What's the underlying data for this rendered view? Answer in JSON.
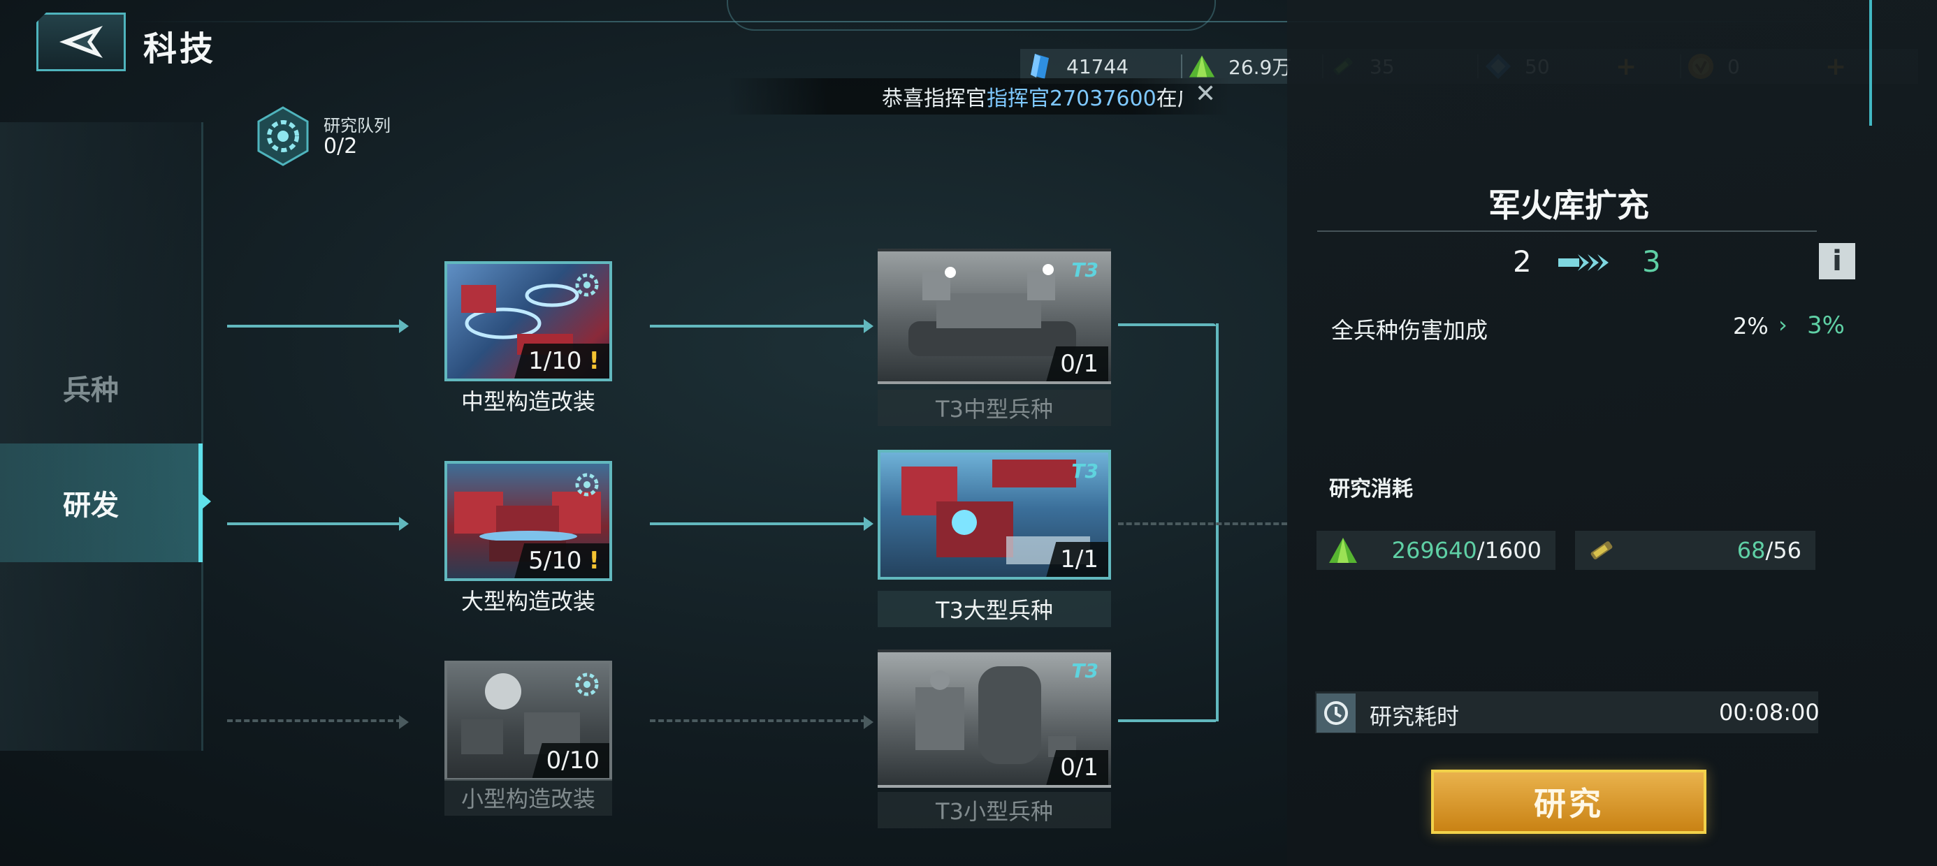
{
  "header": {
    "title": "科技",
    "resources": [
      {
        "icon": "blue-crystal-icon",
        "value": "41744",
        "plus": ""
      },
      {
        "icon": "green-ore-icon",
        "value": "26.9万",
        "plus": ""
      },
      {
        "icon": "green-battery-icon",
        "value": "35",
        "plus": ""
      },
      {
        "icon": "blue-ticket-icon",
        "value": "50",
        "plus": "+"
      },
      {
        "icon": "gold-medal-icon",
        "value": "0",
        "plus": "+"
      }
    ],
    "notice": {
      "prefix": "恭喜指挥官",
      "link": "指挥官27037600",
      "suffix": "在广"
    }
  },
  "queue": {
    "label": "研究队列",
    "value": "0/2"
  },
  "nav": {
    "troops": "兵种",
    "rnd": "研发"
  },
  "tree": {
    "mid_mod": {
      "name": "中型构造改装",
      "progress": "1/10",
      "alert": "!"
    },
    "large_mod": {
      "name": "大型构造改装",
      "progress": "5/10",
      "alert": "!"
    },
    "small_mod": {
      "name": "小型构造改装",
      "progress": "0/10"
    },
    "t3_mid": {
      "name": "T3中型兵种",
      "progress": "0/1",
      "tier": "T3"
    },
    "t3_large": {
      "name": "T3大型兵种",
      "progress": "1/1",
      "tier": "T3"
    },
    "t3_small": {
      "name": "T3小型兵种",
      "progress": "0/1",
      "tier": "T3"
    }
  },
  "detail": {
    "title": "军火库扩充",
    "level_from": "2",
    "level_to": "3",
    "info": "i",
    "effect": {
      "name": "全兵种伤害加成",
      "current": "2%",
      "arrow": "›",
      "next": "3%"
    },
    "cost_title": "研究消耗",
    "costs": [
      {
        "icon": "green-ore-icon",
        "have": "269640",
        "need": "/1600"
      },
      {
        "icon": "battery-icon",
        "have": "68",
        "need": "/56"
      }
    ],
    "time_label": "研究耗时",
    "time_value": "00:08:00",
    "button": "研究"
  },
  "colors": {
    "accent": "#62b8be",
    "highlight": "#5fd0a5",
    "button": "#d9961f",
    "alert": "#f6c432"
  }
}
